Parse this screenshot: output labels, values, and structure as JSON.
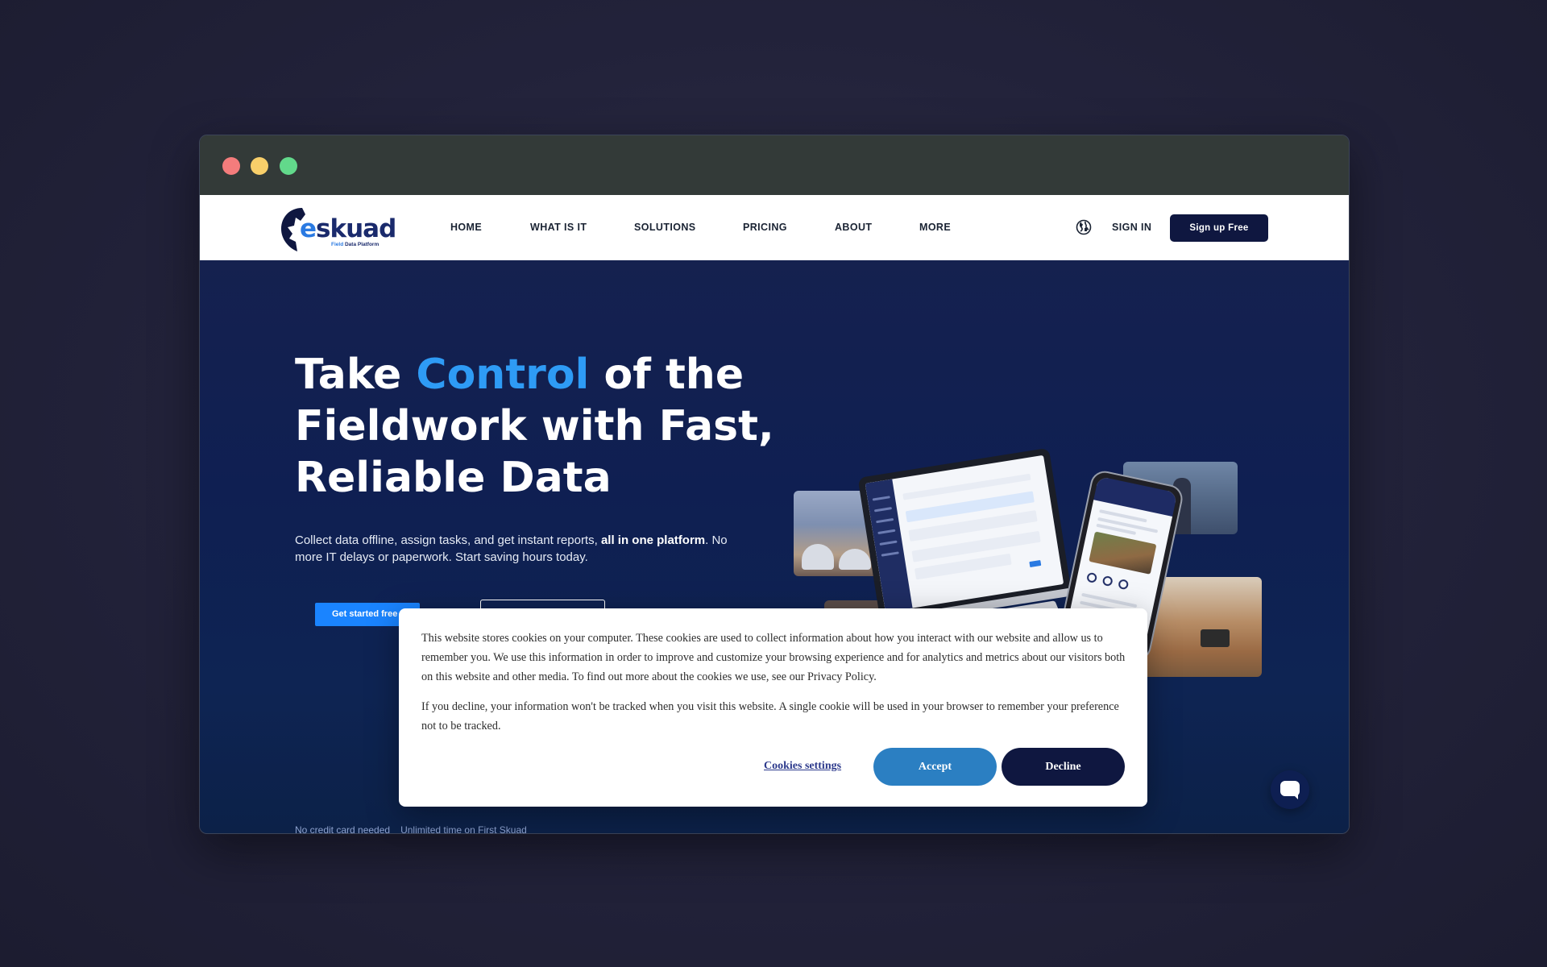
{
  "window": {
    "controls": [
      "close",
      "minimize",
      "maximize"
    ]
  },
  "logo": {
    "word_prefix": "e",
    "word_rest": "skuad",
    "tagline_prefix": "Field",
    "tagline_rest": " Data Platform"
  },
  "nav": {
    "items": [
      "HOME",
      "WHAT IS IT",
      "SOLUTIONS",
      "PRICING",
      "ABOUT",
      "MORE"
    ],
    "signin": "SIGN IN",
    "signup": "Sign up Free",
    "globe_icon": "globe-icon"
  },
  "hero": {
    "title_part1": "Take ",
    "title_accent": "Control",
    "title_part2": " of the Fieldwork with Fast, Reliable Data",
    "subtitle_part1": "Collect data offline, assign tasks, and get instant reports, ",
    "subtitle_bold": "all in one platform",
    "subtitle_part2": ". No more IT delays or paperwork. Start saving hours today.",
    "cta_primary": "Get started free",
    "footnotes": [
      "No credit card needed",
      "Unlimited time on First Skuad"
    ]
  },
  "cookie": {
    "text1": "This website stores cookies on your computer. These cookies are used to collect information about how you interact with our website and allow us to remember you. We use this information in order to improve and customize your browsing experience and for analytics and metrics about our visitors both on this website and other media. To find out more about the cookies we use, see our Privacy Policy.",
    "text2": "If you decline, your information won't be tracked when you visit this website. A single cookie will be used in your browser to remember your preference not to be tracked.",
    "settings": "Cookies settings",
    "accept": "Accept",
    "decline": "Decline"
  },
  "colors": {
    "accent": "#2e9bf5",
    "brand_navy": "#0f1740",
    "cta_blue": "#1a84ff",
    "accept_blue": "#2b7fc2"
  },
  "chat": {
    "icon": "chat-bubble-icon"
  }
}
